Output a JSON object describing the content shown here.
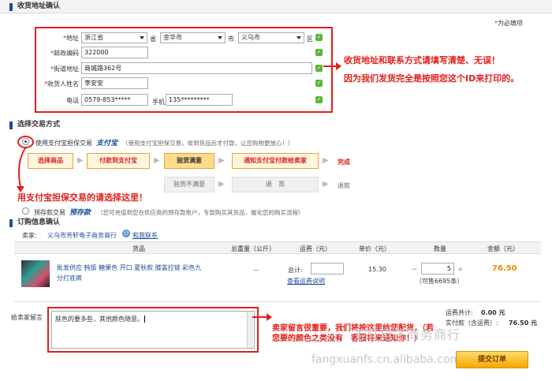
{
  "address_section": {
    "title": "收货地址确认",
    "required_note": "为必填项",
    "region_label": "地址",
    "province": "浙江省",
    "province_suffix": "省",
    "city": "金华市",
    "city_suffix": "市",
    "district": "义乌市",
    "district_suffix": "区",
    "zip_label": "邮政编码",
    "zip": "322000",
    "street_label": "街道地址",
    "street": "商城路362号",
    "name_label": "收货人姓名",
    "name": "李安安",
    "phone_label": "电话",
    "phone": "0579-853*****",
    "mobile_label": "手机",
    "mobile": "135*********",
    "note_line1": "收货地址和联系方式请填写清楚、无误！",
    "note_line2": "因为我们发货完全是按照您这个ID来打印的。"
  },
  "payment_section": {
    "title": "选择交易方式",
    "alipay_label": "使用支付宝担保交易",
    "alipay_brand": "支付宝",
    "alipay_desc": "（使用支付宝担保交易，收到货品后才付款，让您购物更放心！）",
    "steps": [
      "选择商品",
      "付款到支付宝",
      "验货满意",
      "通知支付宝付款给卖家",
      "完成"
    ],
    "alt_steps": [
      "验货不满意",
      "退　货",
      "退款"
    ],
    "alipay_hint": "用支付宝担保交易的请选择这里！",
    "prepay_label": "预存款交易",
    "prepay_brand": "预存款",
    "prepay_desc": "（您可充值到您在供应商的预存款账户，专款购买其货品，催化您的购买流程）"
  },
  "order_section": {
    "title": "订购信息确认",
    "seller_label": "卖家:",
    "seller_name": "义乌市芳轩电子商务商行",
    "contact_label": "和我联系",
    "headers": [
      "货品",
      "总重量（公斤）",
      "运费（元）",
      "单价（元）",
      "数量",
      "金额（元）"
    ],
    "item": {
      "title": "批发供应 韩版 糖果色 开口 夏秋款 膝盖拉链 彩色九分打底裤",
      "weight": "--",
      "freight_label": "总计:",
      "freight_link": "查看运费说明",
      "price": "15.30",
      "quantity": "5",
      "stock": "（可售6695条）",
      "amount": "76.50"
    },
    "message_label": "给卖家留言",
    "message": "肤色的要多些，其他颜色随意。",
    "message_note": "卖家留言很重要，我们将按这里给您配货，（若您要的颜色之类没有　客服将来通知你！）",
    "freight_total_label": "运费共计:",
    "freight_total": "0.00 元",
    "total_label": "实付款（含运费）:",
    "total": "76.50 元",
    "submit_label": "提交订单",
    "watermark": "芳轩电子商务商行",
    "watermark_url": "fangxuanfs.cn.alibaba.com"
  },
  "colors": {
    "accent": "#e0201c",
    "link": "#1a4e9b",
    "orange": "#f08c00"
  }
}
